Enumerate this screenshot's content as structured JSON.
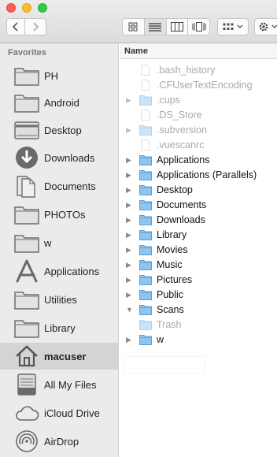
{
  "sidebar": {
    "heading": "Favorites",
    "items": [
      {
        "label": "PH",
        "icon": "folder-icon"
      },
      {
        "label": "Android",
        "icon": "folder-icon"
      },
      {
        "label": "Desktop",
        "icon": "desktop-folder-icon"
      },
      {
        "label": "Downloads",
        "icon": "downloads-icon"
      },
      {
        "label": "Documents",
        "icon": "documents-icon"
      },
      {
        "label": "PHOTOs",
        "icon": "folder-icon"
      },
      {
        "label": "w",
        "icon": "folder-icon"
      },
      {
        "label": "Applications",
        "icon": "applications-icon"
      },
      {
        "label": "Utilities",
        "icon": "folder-icon"
      },
      {
        "label": "Library",
        "icon": "folder-icon"
      },
      {
        "label": "macuser",
        "icon": "home-icon"
      },
      {
        "label": "All My Files",
        "icon": "all-my-files-icon"
      },
      {
        "label": "iCloud Drive",
        "icon": "cloud-icon"
      },
      {
        "label": "AirDrop",
        "icon": "airdrop-icon"
      }
    ],
    "selected_label": "macuser"
  },
  "list": {
    "column_name": "Name",
    "rows": [
      {
        "name": ".bash_history",
        "kind": "file",
        "hidden": true,
        "expandable": false
      },
      {
        "name": ".CFUserTextEncoding",
        "kind": "file",
        "hidden": true,
        "expandable": false
      },
      {
        "name": ".cups",
        "kind": "folder",
        "hidden": true,
        "expandable": true
      },
      {
        "name": ".DS_Store",
        "kind": "file",
        "hidden": true,
        "expandable": false
      },
      {
        "name": ".subversion",
        "kind": "folder",
        "hidden": true,
        "expandable": true
      },
      {
        "name": ".vuescanrc",
        "kind": "file",
        "hidden": true,
        "expandable": false
      },
      {
        "name": "Applications",
        "kind": "folder",
        "hidden": false,
        "expandable": true
      },
      {
        "name": "Applications (Parallels)",
        "kind": "folder",
        "hidden": false,
        "expandable": true
      },
      {
        "name": "Desktop",
        "kind": "folder",
        "hidden": false,
        "expandable": true
      },
      {
        "name": "Documents",
        "kind": "folder",
        "hidden": false,
        "expandable": true
      },
      {
        "name": "Downloads",
        "kind": "folder",
        "hidden": false,
        "expandable": true
      },
      {
        "name": "Library",
        "kind": "folder",
        "hidden": false,
        "expandable": true
      },
      {
        "name": "Movies",
        "kind": "folder",
        "hidden": false,
        "expandable": true
      },
      {
        "name": "Music",
        "kind": "folder",
        "hidden": false,
        "expandable": true
      },
      {
        "name": "Pictures",
        "kind": "folder",
        "hidden": false,
        "expandable": true
      },
      {
        "name": "Public",
        "kind": "folder",
        "hidden": false,
        "expandable": true
      },
      {
        "name": "Scans",
        "kind": "folder",
        "hidden": false,
        "expandable": true,
        "expanded": true
      },
      {
        "name": "Trash",
        "kind": "folder",
        "hidden": true,
        "expandable": false
      },
      {
        "name": "w",
        "kind": "folder",
        "hidden": false,
        "expandable": true
      }
    ]
  },
  "colors": {
    "folder_blue": "#6fb3e8",
    "sidebar_bg": "#ebebeb",
    "selected_bg": "#d4d4d4",
    "hidden_text": "#a9a9a9"
  }
}
